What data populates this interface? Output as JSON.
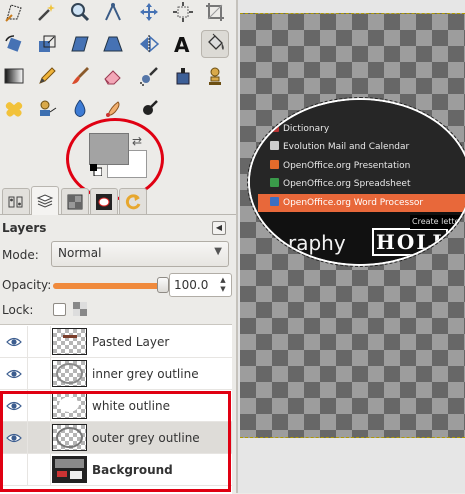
{
  "colors": {
    "foreground": "#a3a3a3",
    "background": "#ffffff",
    "annotation": "#e00012",
    "slider_fill": "#f08a3c"
  },
  "toolbox": {
    "rows": [
      [
        "free-select-icon",
        "fuzzy-select-icon",
        "zoom-icon",
        "measure-icon",
        "move-icon",
        "align-icon",
        "crop-icon"
      ],
      [
        "rotate-icon",
        "scale-icon",
        "shear-icon",
        "perspective-icon",
        "flip-icon",
        "text-icon",
        "bucket-fill-icon"
      ],
      [
        "blend-icon",
        "pencil-icon",
        "paintbrush-icon",
        "eraser-icon",
        "airbrush-icon",
        "ink-icon",
        "clone-icon"
      ],
      [
        "heal-icon",
        "perspective-clone-icon",
        "blur-icon",
        "smudge-icon",
        "dodge-burn-icon"
      ]
    ],
    "active_tool": "bucket-fill-icon"
  },
  "dock_tabs": [
    "tool-options-tab",
    "layers-tab",
    "channels-tab",
    "paths-tab",
    "undo-history-tab"
  ],
  "layers_panel": {
    "title": "Layers",
    "mode_label": "Mode:",
    "mode_value": "Normal",
    "opacity_label": "Opacity:",
    "opacity_value": "100.0",
    "opacity_fraction": 1.0,
    "lock_label": "Lock:",
    "layers": [
      {
        "name": "Pasted Layer",
        "visible": true,
        "bold": false,
        "selected": false
      },
      {
        "name": "inner grey outline",
        "visible": true,
        "bold": false,
        "selected": false
      },
      {
        "name": "white outline",
        "visible": true,
        "bold": false,
        "selected": false
      },
      {
        "name": "outer grey outline",
        "visible": true,
        "bold": false,
        "selected": true
      },
      {
        "name": "Background",
        "visible": false,
        "bold": true,
        "selected": false
      }
    ]
  },
  "canvas_photo": {
    "menu_items": [
      "Dictionary",
      "Evolution Mail and Calendar",
      "OpenOffice.org Presentation",
      "OpenOffice.org Spreadsheet",
      "OpenOffice.org Word Processor"
    ],
    "highlighted_index": 4,
    "text_graphy": "raphy",
    "text_holi": "HOLI",
    "text_tooltip": "Create letter"
  }
}
